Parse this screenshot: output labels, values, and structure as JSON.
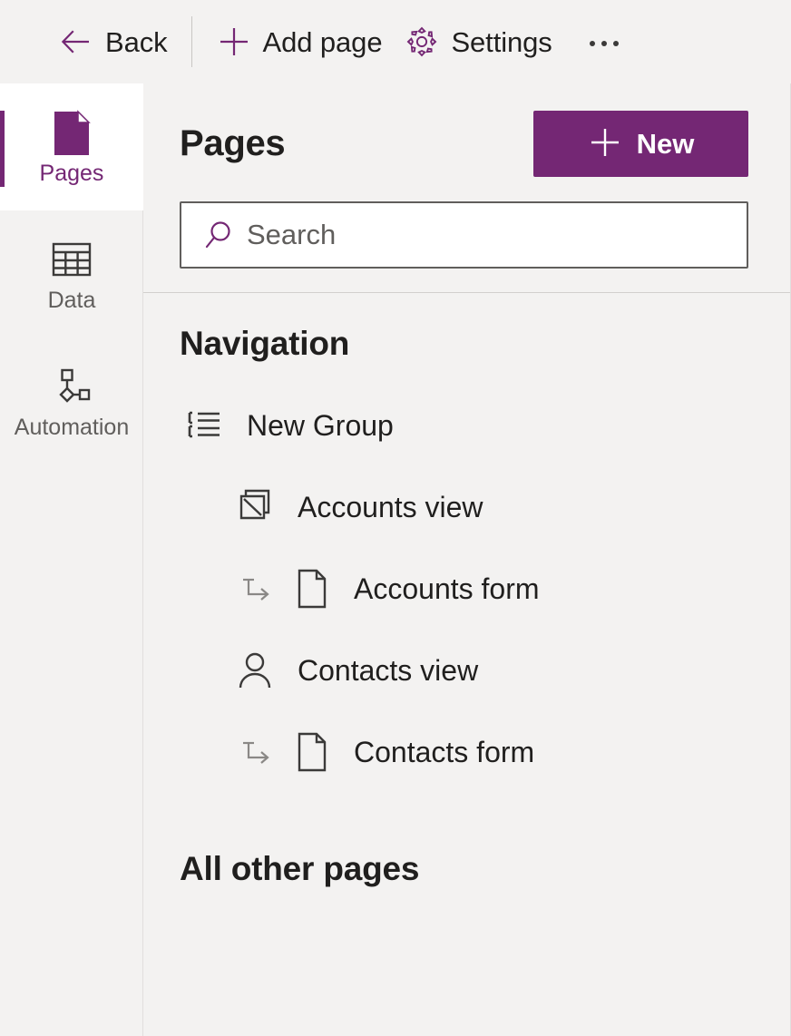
{
  "command_bar": {
    "items": [
      {
        "id": "back",
        "label": "Back",
        "icon": "back-arrow-icon"
      },
      {
        "id": "add-page",
        "label": "Add page",
        "icon": "plus-icon"
      },
      {
        "id": "settings",
        "label": "Settings",
        "icon": "gear-icon"
      }
    ],
    "overflow_label": "More commands",
    "overflow_icon": "ellipsis-icon"
  },
  "rail": {
    "items": [
      {
        "id": "pages",
        "label": "Pages",
        "icon": "page-filled-icon",
        "selected": true
      },
      {
        "id": "data",
        "label": "Data",
        "icon": "table-grid-icon",
        "selected": false
      },
      {
        "id": "automation",
        "label": "Automation",
        "icon": "flow-nodes-icon",
        "selected": false
      }
    ]
  },
  "panel": {
    "title": "Pages",
    "new_button": {
      "label": "New",
      "icon": "plus-icon"
    },
    "search": {
      "placeholder": "Search",
      "value": "",
      "icon": "search-icon"
    }
  },
  "navigation": {
    "title": "Navigation",
    "tree": [
      {
        "id": "new-group",
        "label": "New Group",
        "icon": "group-list-icon",
        "level": 1
      },
      {
        "id": "accounts-view",
        "label": "Accounts view",
        "icon": "entity-view-icon",
        "level": 2
      },
      {
        "id": "accounts-form",
        "label": "Accounts form",
        "icon": "document-page-icon",
        "level": 3,
        "sub_arrow": "subarea-arrow-icon"
      },
      {
        "id": "contacts-view",
        "label": "Contacts view",
        "icon": "person-icon",
        "level": 2
      },
      {
        "id": "contacts-form",
        "label": "Contacts form",
        "icon": "document-page-icon",
        "level": 3,
        "sub_arrow": "subarea-arrow-icon"
      }
    ]
  },
  "all_other_pages": {
    "title": "All other pages"
  },
  "colors": {
    "accent": "#742774",
    "surface": "#f3f2f1",
    "white": "#ffffff",
    "text": "#201f1e",
    "secondary_text": "#605e5c",
    "border": "#d2d0ce",
    "icon_stroke": "#3b3a39",
    "subarea_arrow": "#8a8886"
  }
}
